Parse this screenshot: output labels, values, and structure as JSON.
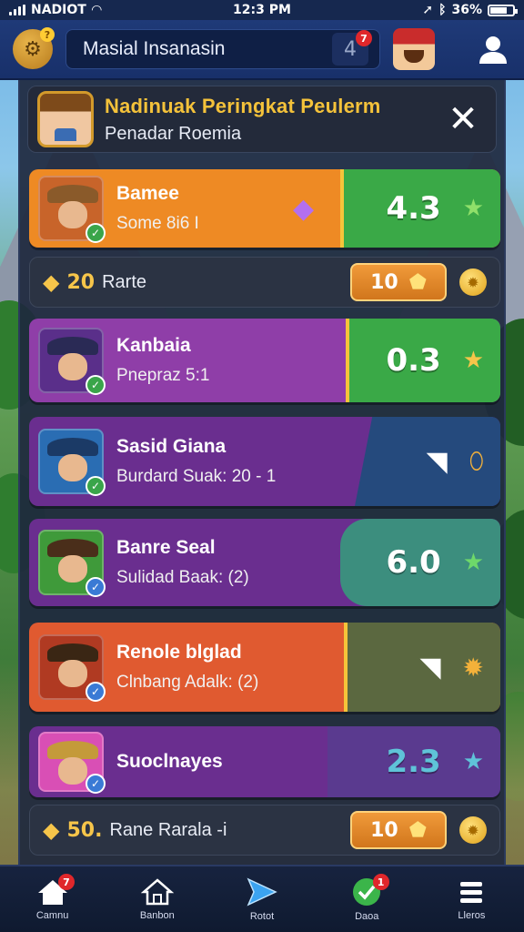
{
  "status_bar": {
    "carrier": "NADIOT",
    "time": "12:3 PM",
    "battery": "36%"
  },
  "app_bar": {
    "search_text": "Masial Insanasin",
    "notification_count": "7",
    "gear_badge": "?"
  },
  "panel": {
    "title": "Nadinuak Peringkat Peulerm",
    "subtitle": "Penadar Roemia"
  },
  "rows": [
    {
      "name": "Bamee",
      "subtitle": "Some 8i6 I",
      "score": "4.3",
      "color_left": "#ee8a24",
      "color_right": "#3aa947",
      "icon": "gem-icon"
    },
    {
      "name": "Kanbaia",
      "subtitle": "Pnepraz 5:1",
      "score": "0.3",
      "color_left": "#8f3ea8",
      "color_right": "#3aa947",
      "icon": ""
    },
    {
      "name": "Sasid Giana",
      "subtitle": "Burdard Suak: 20 - 1",
      "score": "",
      "color_left": "#6a2e8f",
      "color_right": "#254a7d",
      "icon": ""
    },
    {
      "name": "Banre Seal",
      "subtitle": "Sulidad Baak: (2)",
      "score": "6.0",
      "color_left": "#6a2e8f",
      "color_right": "#3c8e7e",
      "icon": ""
    },
    {
      "name": "Renole blglad",
      "subtitle": "Clnbang Adalk: (2)",
      "score": "",
      "color_left": "#e05a30",
      "color_right": "#5b6840",
      "icon": ""
    },
    {
      "name": "Suoclnayes",
      "subtitle": "",
      "score": "2.3",
      "color_left": "#6a2e8f",
      "color_right": "#5a3a8f",
      "icon": ""
    }
  ],
  "rewards": [
    {
      "amount": "20",
      "label": "Rarte",
      "chip_value": "10"
    },
    {
      "amount": "50.",
      "label": "Rane Rarala -i",
      "chip_value": "10"
    }
  ],
  "bottom_nav": [
    {
      "label": "Camnu",
      "icon": "home-icon",
      "badge": "7"
    },
    {
      "label": "Banbon",
      "icon": "house-outline-icon",
      "badge": ""
    },
    {
      "label": "Rotot",
      "icon": "play-icon",
      "badge": ""
    },
    {
      "label": "Daoa",
      "icon": "check-circle-icon",
      "badge": "1"
    },
    {
      "label": "Lleros",
      "icon": "menu-icon",
      "badge": ""
    }
  ]
}
